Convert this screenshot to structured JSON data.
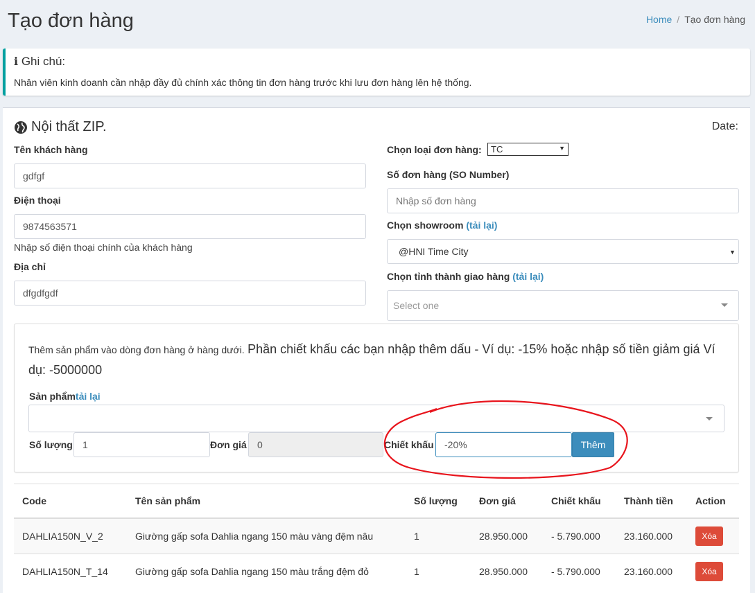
{
  "header": {
    "title": "Tạo đơn hàng",
    "breadcrumb_home": "Home",
    "breadcrumb_sep": "/",
    "breadcrumb_current": "Tạo đơn hàng"
  },
  "note": {
    "title": "Ghi chú:",
    "text": "Nhân viên kinh doanh cần nhập đầy đủ chính xác thông tin đơn hàng trước khi lưu đơn hàng lên hệ thống."
  },
  "company": "Nội thất ZIP.",
  "date_label": "Date:",
  "customer": {
    "name_label": "Tên khách hàng",
    "name_value": "gdfgf",
    "phone_label": "Điện thoại",
    "phone_value": "9874563571",
    "phone_help": "Nhập số điện thoại chính của khách hàng",
    "address_label": "Địa chỉ",
    "address_value": "dfgdfgdf"
  },
  "order": {
    "type_label": "Chọn loại đơn hàng:",
    "type_value": "TC",
    "so_label": "Số đơn hàng (SO Number)",
    "so_placeholder": "Nhập số đơn hàng",
    "showroom_label": "Chọn showroom",
    "reload": "(tải lại)",
    "showroom_value": "@HNI Time City",
    "province_label": "Chọn tỉnh thành giao hàng",
    "province_placeholder": "Select one"
  },
  "product_form": {
    "instruction_small": "Thêm sản phẩm vào dòng đơn hàng ở hàng dưới.",
    "instruction_large": "Phần chiết khấu các bạn nhập thêm dấu - Ví dụ: -15% hoặc nhập số tiền giảm giá Ví dụ: -5000000",
    "product_label": "Sản phẩm",
    "product_reload": "tải lại",
    "qty_label": "Số lượng",
    "qty_value": "1",
    "price_label": "Đơn giá",
    "price_value": "0",
    "discount_label": "Chiết khấu",
    "discount_value": "-20%",
    "add_button": "Thêm"
  },
  "table": {
    "headers": [
      "Code",
      "Tên sản phẩm",
      "Số lượng",
      "Đơn giá",
      "Chiết khấu",
      "Thành tiền",
      "Action"
    ],
    "rows": [
      [
        "DAHLIA150N_V_2",
        "Giường gấp sofa Dahlia ngang 150 màu vàng đệm nâu",
        "1",
        "28.950.000",
        "- 5.790.000",
        "23.160.000",
        "Xóa"
      ],
      [
        "DAHLIA150N_T_14",
        "Giường gấp sofa Dahlia ngang 150 màu trắng đệm đỏ",
        "1",
        "28.950.000",
        "- 5.790.000",
        "23.160.000",
        "Xóa"
      ]
    ]
  },
  "colors": {
    "accent": "#3c8dbc",
    "danger": "#dd4b39",
    "annotation": "#e8141c"
  }
}
